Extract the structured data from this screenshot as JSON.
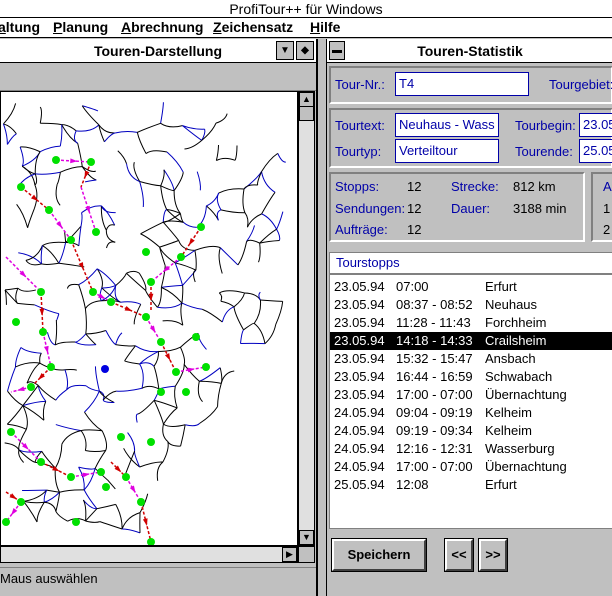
{
  "app": {
    "title": "ProfiTour++ für Windows"
  },
  "menu": [
    "altung",
    "Planung",
    "Abrechnung",
    "Zeichensatz",
    "Hilfe"
  ],
  "left_window": {
    "title": "Touren-Darstellung",
    "status": "Maus auswählen"
  },
  "right_window": {
    "title": "Touren-Statistik",
    "tour_nr_label": "Tour-Nr.:",
    "tour_nr_value": "T4",
    "tourgebiet_label": "Tourgebiet:",
    "tourtext_label": "Tourtext:",
    "tourtext_value": "Neuhaus - Wass",
    "tourbegin_label": "Tourbegin:",
    "tourbegin_value": "23.05",
    "tourtyp_label": "Tourtyp:",
    "tourtyp_value": "Verteiltour",
    "tourende_label": "Tourende:",
    "tourende_value": "25.05",
    "stats": {
      "stopps_label": "Stopps:",
      "stopps_value": "12",
      "sendungen_label": "Sendungen:",
      "sendungen_value": "12",
      "auftraege_label": "Aufträge:",
      "auftraege_value": "12",
      "strecke_label": "Strecke:",
      "strecke_value": "812 km",
      "dauer_label": "Dauer:",
      "dauer_value": "3188 min",
      "extra_label": "A",
      "extra_v1": "1",
      "extra_v2": "2"
    },
    "stops_header": "Tourstopps",
    "stops": [
      {
        "date": "23.05.94",
        "time": "07:00",
        "place": "Erfurt",
        "selected": false
      },
      {
        "date": "23.05.94",
        "time": "08:37 - 08:52",
        "place": "Neuhaus",
        "selected": false
      },
      {
        "date": "23.05.94",
        "time": "11:28 - 11:43",
        "place": "Forchheim",
        "selected": false
      },
      {
        "date": "23.05.94",
        "time": "14:18 - 14:33",
        "place": "Crailsheim",
        "selected": true
      },
      {
        "date": "23.05.94",
        "time": "15:32 - 15:47",
        "place": "Ansbach",
        "selected": false
      },
      {
        "date": "23.05.94",
        "time": "16:44 - 16:59",
        "place": "Schwabach",
        "selected": false
      },
      {
        "date": "23.05.94",
        "time": "17:00 - 07:00",
        "place": "Übernachtung",
        "selected": false
      },
      {
        "date": "24.05.94",
        "time": "09:04 - 09:19",
        "place": "Kelheim",
        "selected": false
      },
      {
        "date": "24.05.94",
        "time": "09:19 - 09:34",
        "place": "Kelheim",
        "selected": false
      },
      {
        "date": "24.05.94",
        "time": "12:16 - 12:31",
        "place": "Wasserburg",
        "selected": false
      },
      {
        "date": "24.05.94",
        "time": "17:00 - 07:00",
        "place": "Übernachtung",
        "selected": false
      },
      {
        "date": "25.05.94",
        "time": "12:08",
        "place": "Erfurt",
        "selected": false
      }
    ],
    "buttons": {
      "save": "Speichern",
      "prev": "<<",
      "next": ">>"
    }
  },
  "colors": {
    "label_blue": "#0000a8",
    "road_black": "#000000",
    "road_blue": "#0000c0",
    "stop_green": "#00e000",
    "route_magenta": "#e000e0",
    "route_red": "#d00000"
  }
}
